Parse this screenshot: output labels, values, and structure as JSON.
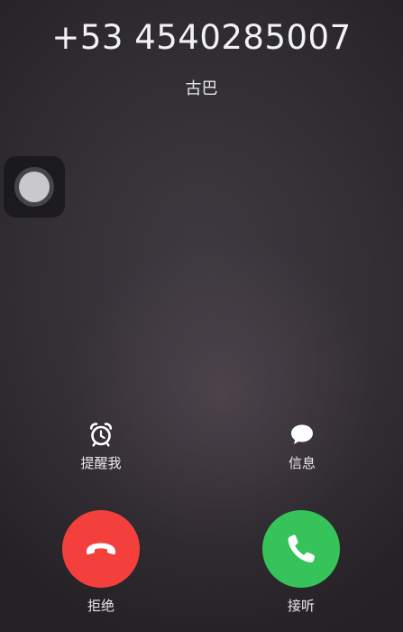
{
  "caller": {
    "number": "+53 4540285007",
    "location": "古巴"
  },
  "actions": {
    "remind_me": {
      "label": "提醒我",
      "icon": "alarm-clock-icon"
    },
    "message": {
      "label": "信息",
      "icon": "message-bubble-icon"
    },
    "decline": {
      "label": "拒绝",
      "icon": "hang-up-icon",
      "color": "#f4403d"
    },
    "accept": {
      "label": "接听",
      "icon": "phone-icon",
      "color": "#35c35a"
    }
  },
  "overlay": {
    "icon": "assistive-touch-icon"
  }
}
